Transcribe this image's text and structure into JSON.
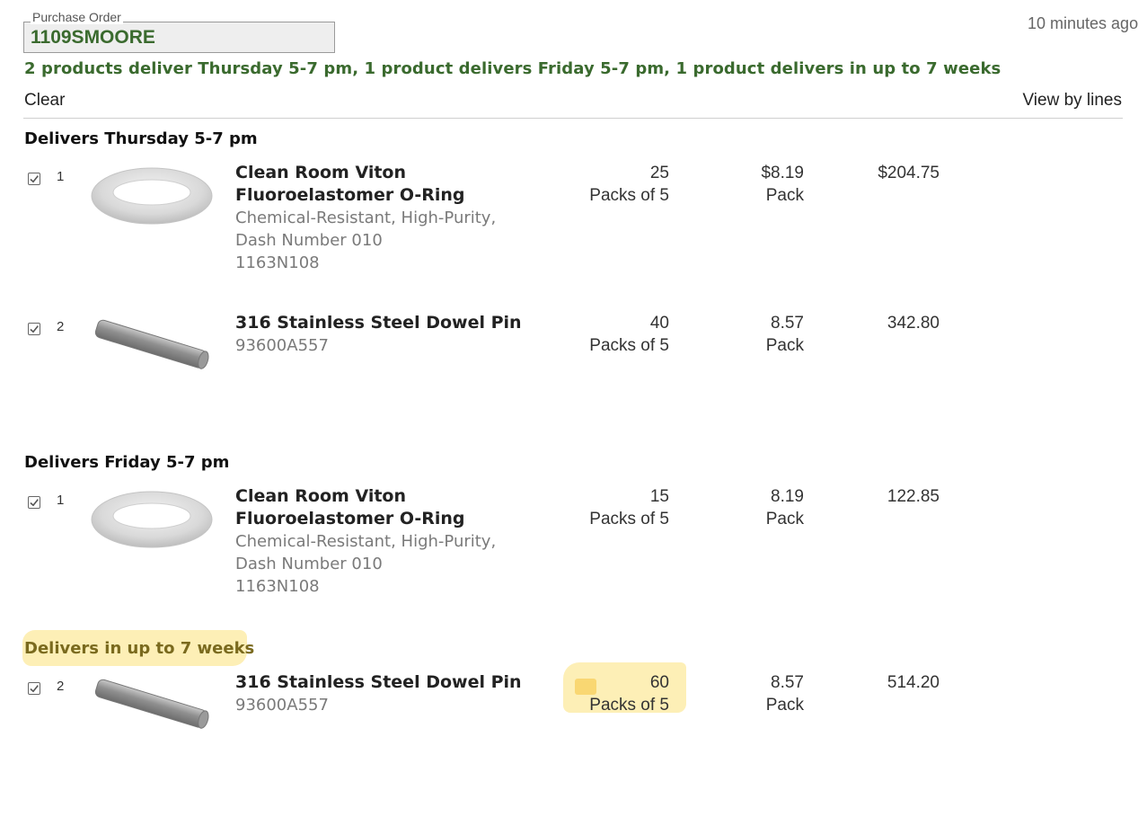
{
  "po": {
    "label": "Purchase Order",
    "value": "1109SMOORE"
  },
  "timestamp": "10 minutes ago",
  "summary": "2 products deliver Thursday 5-7 pm, 1 product delivers Friday 5-7 pm, 1 product delivers in up to 7 weeks",
  "actions": {
    "clear": "Clear",
    "view_by_lines": "View by lines"
  },
  "groups": [
    {
      "heading": "Delivers Thursday 5-7 pm",
      "items": [
        {
          "checked": true,
          "line": "1",
          "image": "o-ring-image",
          "name_lines": [
            "Clean Room Viton",
            "Fluoroelastomer O-Ring"
          ],
          "desc_lines": [
            "Chemical-Resistant, High-Purity,",
            "Dash Number 010"
          ],
          "part_number": "1163N108",
          "qty": "25",
          "qty_unit": "Packs of 5",
          "price": "$8.19",
          "price_unit": "Pack",
          "total": "$204.75"
        },
        {
          "checked": true,
          "line": "2",
          "image": "dowel-pin-image",
          "name_lines": [
            "316 Stainless Steel Dowel Pin"
          ],
          "desc_lines": [],
          "part_number": "93600A557",
          "qty": "40",
          "qty_unit": "Packs of 5",
          "price": "8.57",
          "price_unit": "Pack",
          "total": "342.80"
        }
      ]
    },
    {
      "heading": "Delivers Friday 5-7 pm",
      "items": [
        {
          "checked": true,
          "line": "1",
          "image": "o-ring-image",
          "name_lines": [
            "Clean Room Viton",
            "Fluoroelastomer O-Ring"
          ],
          "desc_lines": [
            "Chemical-Resistant, High-Purity,",
            "Dash Number 010"
          ],
          "part_number": "1163N108",
          "qty": "15",
          "qty_unit": "Packs of 5",
          "price": "8.19",
          "price_unit": "Pack",
          "total": "122.85"
        }
      ]
    },
    {
      "heading": "Delivers in up to 7 weeks",
      "highlighted": true,
      "items": [
        {
          "checked": true,
          "line": "2",
          "image": "dowel-pin-image",
          "name_lines": [
            "316 Stainless Steel Dowel Pin"
          ],
          "desc_lines": [],
          "part_number": "93600A557",
          "qty": "60",
          "qty_unit": "Packs of 5",
          "price": "8.57",
          "price_unit": "Pack",
          "total": "514.20",
          "qty_highlighted": true
        }
      ]
    }
  ],
  "colors": {
    "accent_green": "#3a6a2e",
    "highlight": "#fbe27a"
  }
}
